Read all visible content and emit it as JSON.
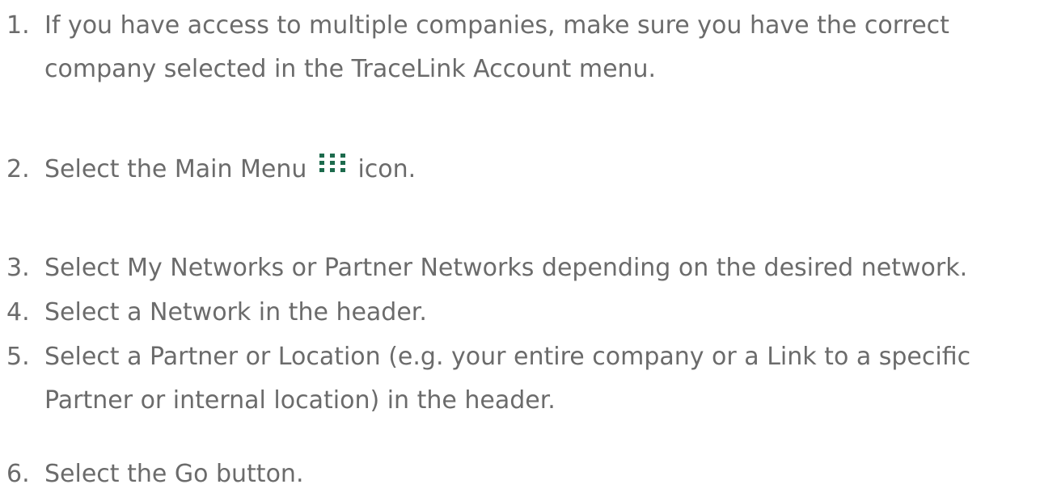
{
  "steps": [
    {
      "number": "1.",
      "line1": "If you have access to multiple companies, make sure you have the correct",
      "line2": "company selected in the TraceLink Account menu."
    },
    {
      "number": "2.",
      "before": "Select the Main Menu",
      "icon": "main-menu-grid-icon",
      "after": "icon."
    },
    {
      "number": "3.",
      "line1": "Select My Networks or Partner Networks depending on the desired network."
    },
    {
      "number": "4.",
      "line1": "Select a Network in the header."
    },
    {
      "number": "5.",
      "line1": "Select a Partner or Location (e.g. your entire company or a Link to a specific",
      "line2": "Partner or internal location) in the header."
    },
    {
      "number": "6.",
      "line1": "Select the Go button."
    }
  ],
  "colors": {
    "text": "#6b6b6b",
    "icon": "#1d6b4d"
  }
}
